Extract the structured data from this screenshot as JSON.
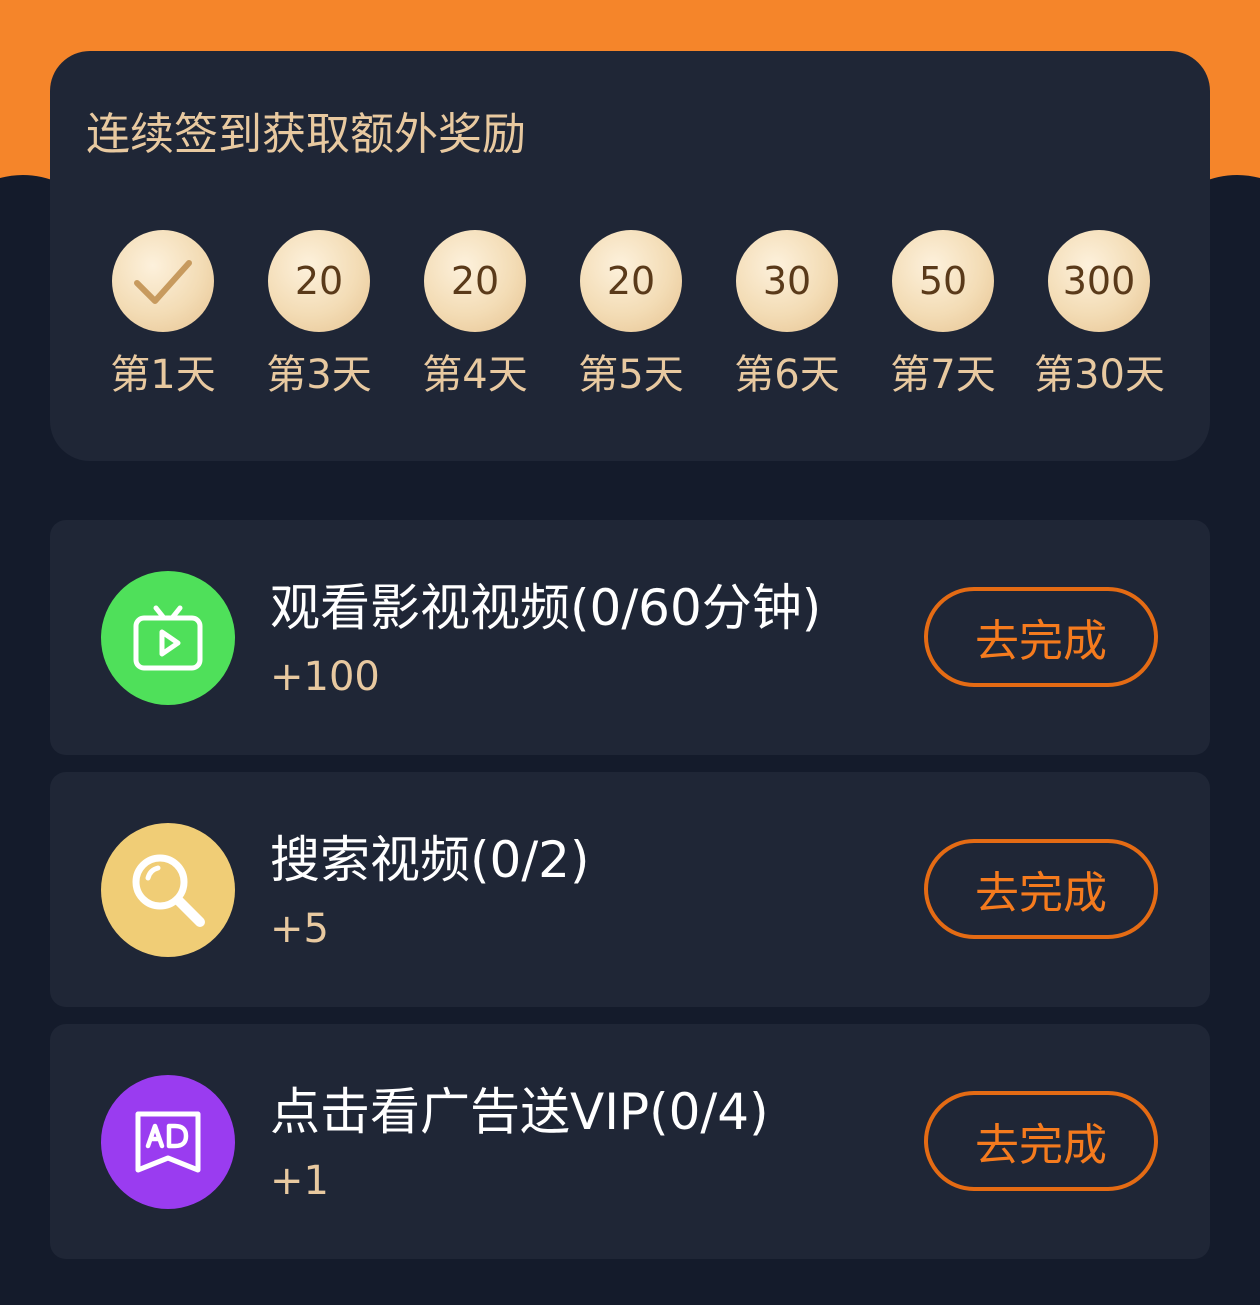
{
  "signin": {
    "title": "连续签到获取额外奖励",
    "days": [
      {
        "label": "第1天",
        "reward": "",
        "checked": true
      },
      {
        "label": "第3天",
        "reward": "20",
        "checked": false
      },
      {
        "label": "第4天",
        "reward": "20",
        "checked": false
      },
      {
        "label": "第5天",
        "reward": "20",
        "checked": false
      },
      {
        "label": "第6天",
        "reward": "30",
        "checked": false
      },
      {
        "label": "第7天",
        "reward": "50",
        "checked": false
      },
      {
        "label": "第30天",
        "reward": "300",
        "checked": false
      }
    ]
  },
  "tasks": [
    {
      "icon": "tv-play-icon",
      "icon_color": "#4fe05a",
      "title": "观看影视视频(0/60分钟)",
      "reward": "+100",
      "button": "去完成"
    },
    {
      "icon": "search-icon",
      "icon_color": "#f0cd76",
      "title": "搜索视频(0/2)",
      "reward": "+5",
      "button": "去完成"
    },
    {
      "icon": "ad-icon",
      "icon_color": "#9a3cf0",
      "title": "点击看广告送VIP(0/4)",
      "reward": "+1",
      "button": "去完成"
    }
  ],
  "colors": {
    "accent_orange": "#f5852a",
    "page_bg": "#141b2b",
    "card_bg": "#1f2636",
    "gold_text": "#e8c9a0",
    "button_border": "#e46b14"
  }
}
